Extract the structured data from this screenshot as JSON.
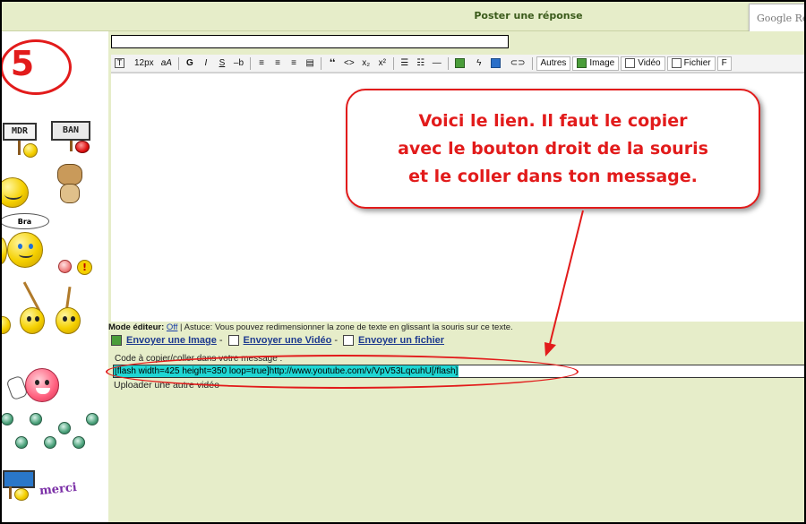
{
  "header": {
    "title": "Poster une réponse",
    "google_label": "Google Re"
  },
  "step": {
    "number": "5"
  },
  "smileys": {
    "sign_mdr": "MDR",
    "sign_ban": "BAN",
    "bubble": "Bra",
    "merci": "merci"
  },
  "toolbar": {
    "font_size": "12px",
    "font_face": "aA",
    "bold": "G",
    "italic": "I",
    "underline": "S",
    "strike": "–b",
    "quote": "❛❛",
    "code": "<>",
    "sub": "x₂",
    "sup": "x²",
    "autres": "Autres",
    "image": "Image",
    "video": "Vidéo",
    "fichier": "Fichier",
    "overflow": "F"
  },
  "editor": {
    "mode_label": "Mode éditeur:",
    "mode_value": "Off",
    "tip": " | Astuce: Vous pouvez redimensionner la zone de texte en glissant la souris sur ce texte."
  },
  "links": {
    "send_image": "Envoyer une Image",
    "send_video": "Envoyer une Vidéo",
    "send_file": "Envoyer un fichier",
    "separator": "-"
  },
  "code": {
    "label": "Code à copier/coller dans votre message :",
    "value": "[flash width=425 height=350 loop=true]http://www.youtube.com/v/VpV53LqcuhU[/flash]"
  },
  "upload_other": "Uploader une autre vidéo",
  "callout": {
    "line1": "Voici le lien. Il faut le copier",
    "line2": "avec le bouton droit de la souris",
    "line3": "et le coller dans ton message."
  },
  "colors": {
    "annotation": "#e21b1b",
    "panel_bg": "#e6edc9",
    "code_highlight": "#1fd6d3",
    "link": "#1f3b8f"
  }
}
